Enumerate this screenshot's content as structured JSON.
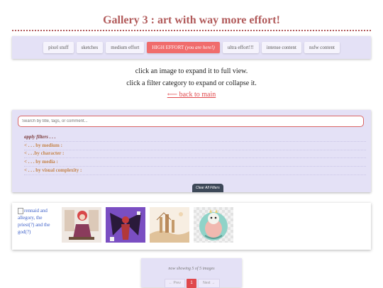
{
  "header": {
    "title": "Gallery 3 : art with way more effort!"
  },
  "tabs": [
    {
      "label": "pixel stuff",
      "sub": ""
    },
    {
      "label": "sketches",
      "sub": ""
    },
    {
      "label": "medium effort",
      "sub": ""
    },
    {
      "label": "HIGH EFFORT",
      "sub": "(you are here!)",
      "active": true
    },
    {
      "label": "ultra effort!!!",
      "sub": ""
    },
    {
      "label": "intense content",
      "sub": ""
    },
    {
      "label": "nsfw content",
      "sub": ""
    }
  ],
  "info": {
    "line1": "click an image to expand it to full view.",
    "line2": "click a filter category to expand or collapse it.",
    "back_link": "⟵ back to main"
  },
  "filters": {
    "search_placeholder": "Search by title, tags, or comment...",
    "apply_label": "apply filters . . .",
    "categories": [
      "< . . . by medium :",
      "< . . .by character :",
      "< . . . by media :",
      "< . . . by visual complexity :"
    ],
    "clear_label": "Clear All Filters"
  },
  "gallery": {
    "broken_alt": "rennaid and allegory, the priest(?) and the god(?)",
    "thumbnails": [
      "seated figure drawing",
      "dark winged figure",
      "sepia landscape",
      "teal dragon"
    ]
  },
  "pager": {
    "status": "now showing 5 of 5 images",
    "prev_label": "← Prev",
    "current_page": "1",
    "next_label": "Next →"
  }
}
